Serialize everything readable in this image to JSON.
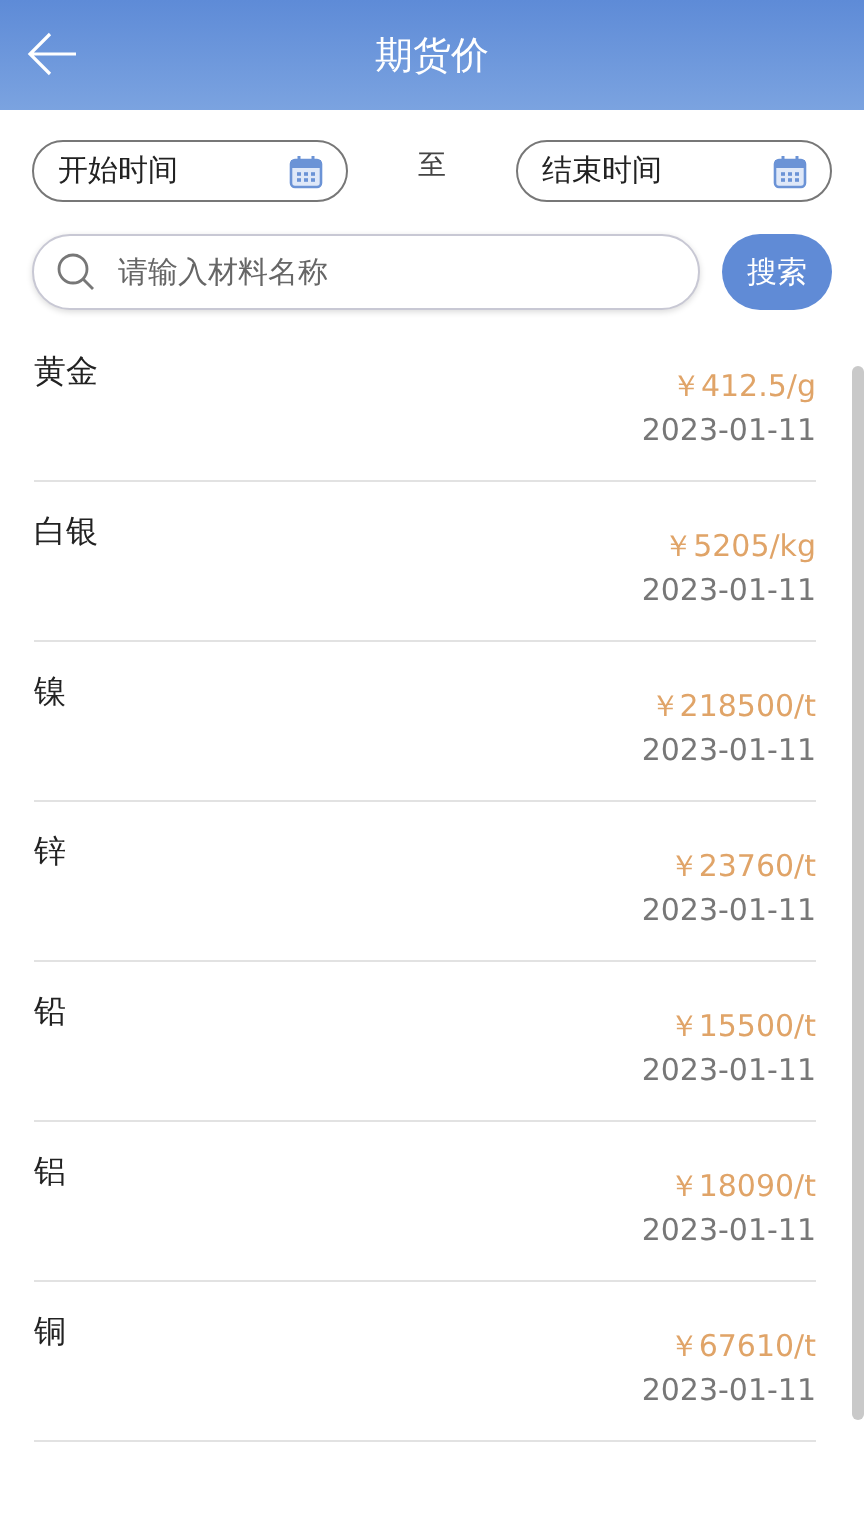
{
  "header": {
    "title": "期货价"
  },
  "date_range": {
    "start_placeholder": "开始时间",
    "separator": "至",
    "end_placeholder": "结束时间"
  },
  "search": {
    "placeholder": "请输入材料名称",
    "button": "搜索"
  },
  "items": [
    {
      "name": "黄金",
      "price": "￥412.5/g",
      "date": "2023-01-11"
    },
    {
      "name": "白银",
      "price": "￥5205/kg",
      "date": "2023-01-11"
    },
    {
      "name": "镍",
      "price": "￥218500/t",
      "date": "2023-01-11"
    },
    {
      "name": "锌",
      "price": "￥23760/t",
      "date": "2023-01-11"
    },
    {
      "name": "铅",
      "price": "￥15500/t",
      "date": "2023-01-11"
    },
    {
      "name": "铝",
      "price": "￥18090/t",
      "date": "2023-01-11"
    },
    {
      "name": "铜",
      "price": "￥67610/t",
      "date": "2023-01-11"
    }
  ]
}
